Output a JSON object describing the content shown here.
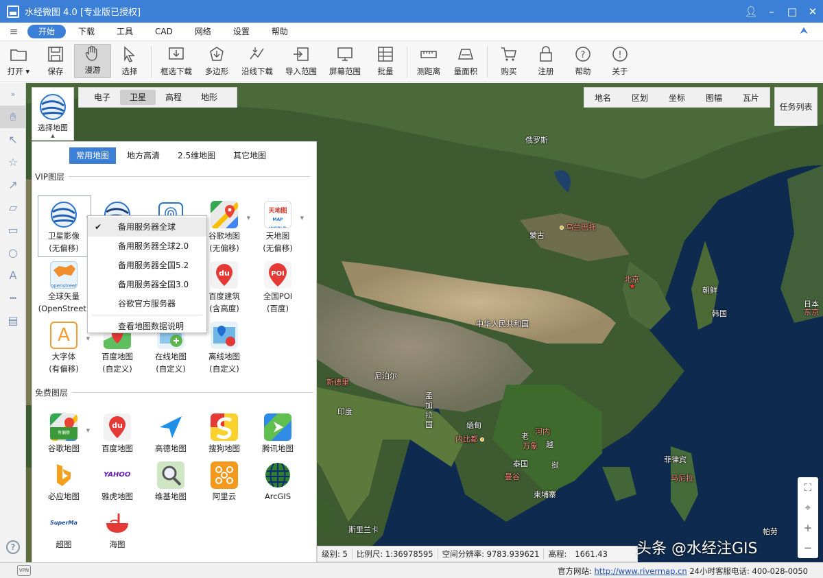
{
  "titlebar": {
    "title": "水经微图 4.0 [专业版已授权]"
  },
  "menu": {
    "items": [
      "开始",
      "下载",
      "工具",
      "CAD",
      "网络",
      "设置",
      "帮助"
    ],
    "active": "开始"
  },
  "ribbon": {
    "buttons": [
      {
        "label": "打开 ▾",
        "icon": "folder-icon"
      },
      {
        "label": "保存",
        "icon": "save-icon"
      },
      {
        "label": "漫游",
        "icon": "hand-icon",
        "active": true
      },
      {
        "label": "选择",
        "icon": "cursor-icon"
      },
      {
        "label": "框选下载",
        "icon": "box-download-icon"
      },
      {
        "label": "多边形",
        "icon": "polygon-download-icon"
      },
      {
        "label": "沿线下载",
        "icon": "line-download-icon"
      },
      {
        "label": "导入范围",
        "icon": "import-range-icon"
      },
      {
        "label": "屏幕范围",
        "icon": "screen-range-icon"
      },
      {
        "label": "批量",
        "icon": "batch-icon"
      },
      {
        "label": "测距离",
        "icon": "ruler-icon"
      },
      {
        "label": "量面积",
        "icon": "area-icon"
      },
      {
        "label": "购买",
        "icon": "cart-icon"
      },
      {
        "label": "注册",
        "icon": "lock-icon"
      },
      {
        "label": "帮助",
        "icon": "help-icon"
      },
      {
        "label": "关于",
        "icon": "info-icon"
      }
    ]
  },
  "map_types": {
    "items": [
      "电子",
      "卫星",
      "高程",
      "地形"
    ],
    "active": "卫星"
  },
  "right_bar": {
    "items": [
      "地名",
      "区划",
      "坐标",
      "图幅",
      "瓦片"
    ]
  },
  "task_list": {
    "label": "任务列表"
  },
  "select_map": {
    "label": "选择地图"
  },
  "panel": {
    "tabs": [
      "常用地图",
      "地方高清",
      "2.5维地图",
      "其它地图"
    ],
    "active_tab": "常用地图",
    "vip_title": "VIP图层",
    "free_title": "免费图层",
    "vip_tiles": [
      {
        "line1": "卫星影像",
        "line2": "(无偏移)",
        "icon": "globe-icon"
      },
      {
        "line1": "",
        "line2": "",
        "icon": "globe-icon"
      },
      {
        "line1": "",
        "line2": "",
        "icon": "fingerprint-icon"
      },
      {
        "line1": "谷歌地图",
        "line2": "(无偏移)",
        "icon": "google-maps-icon"
      },
      {
        "line1": "天地图",
        "line2": "(无偏移)",
        "icon": "tianditu-icon"
      },
      {
        "line1": "全球矢量",
        "line2": "(OpenStreet)",
        "icon": "openstreet-icon"
      },
      {
        "line1": "百度建筑",
        "line2": "(含高度)",
        "icon": "baidu-building-icon"
      },
      {
        "line1": "全国POI",
        "line2": "(百度)",
        "icon": "poi-icon"
      },
      {
        "line1": "大字体",
        "line2": "(有偏移)",
        "icon": "large-font-icon"
      },
      {
        "line1": "百度地图",
        "line2": "(自定义)",
        "icon": "baidu-custom-icon"
      },
      {
        "line1": "在线地图",
        "line2": "(自定义)",
        "icon": "online-map-icon"
      },
      {
        "line1": "离线地图",
        "line2": "(自定义)",
        "icon": "offline-map-icon"
      }
    ],
    "free_tiles": [
      {
        "line1": "谷歌地图",
        "icon": "google-maps-icon"
      },
      {
        "line1": "百度地图",
        "icon": "baidu-map-icon"
      },
      {
        "line1": "高德地图",
        "icon": "gaode-icon"
      },
      {
        "line1": "搜狗地图",
        "icon": "sogou-icon"
      },
      {
        "line1": "腾讯地图",
        "icon": "tencent-map-icon"
      },
      {
        "line1": "必应地图",
        "icon": "bing-icon"
      },
      {
        "line1": "雅虎地图",
        "icon": "yahoo-icon"
      },
      {
        "line1": "维基地图",
        "icon": "wiki-map-icon"
      },
      {
        "line1": "阿里云",
        "icon": "aliyun-icon"
      },
      {
        "line1": "ArcGIS",
        "icon": "arcgis-icon"
      },
      {
        "line1": "超图",
        "icon": "supermap-icon"
      },
      {
        "line1": "海图",
        "icon": "sea-chart-icon"
      }
    ],
    "tile_texts": {
      "openstreet_badge": "openstreet",
      "poi_badge": "POI",
      "baidu_du": "du",
      "yahoo": "YAHOO!",
      "supermap": "SuperMap",
      "tianditu": "天地图",
      "tianditu_sub": "MAP WORLD",
      "google_sub": "有偏移",
      "large_font": "A"
    }
  },
  "dropdown": {
    "items": [
      "备用服务器全球",
      "备用服务器全球2.0",
      "备用服务器全国5.2",
      "备用服务器全国3.0",
      "谷歌官方服务器",
      "查看地图数据说明"
    ],
    "checked": "备用服务器全球"
  },
  "map_labels": {
    "russia": "俄罗斯",
    "mongolia": "蒙古",
    "ulaanbaatar": "乌兰巴托",
    "beijing": "北京",
    "korea_n": "朝鲜",
    "korea_s": "韩国",
    "japan": "日本",
    "tokyo": "东京",
    "china": "中华人民共和国",
    "nepal": "尼泊尔",
    "newdelhi": "新德里",
    "bangladesh_a": "孟",
    "bangladesh_b": "加",
    "bangladesh_c": "拉",
    "bangladesh_d": "国",
    "india": "印度",
    "myanmar": "缅甸",
    "naypyidaw": "内比都",
    "hanoi": "河内",
    "laos": "老",
    "vientiane": "万象",
    "vietnam": "越",
    "thailand": "泰国",
    "bangkok": "曼谷",
    "cambodia": "柬埔寨",
    "vietnam2": "挝",
    "philippines": "菲律宾",
    "manila": "马尼拉",
    "srilanka": "斯里兰卡",
    "palau": "帕劳"
  },
  "status": {
    "level": "级别: 5",
    "scale": "比例尺: 1:36978595",
    "resolution": "空间分辨率: 9783.939621",
    "elevation": "高程:",
    "elev_value": "1661.43"
  },
  "watermark": "头条 @水经注GIS",
  "footer": {
    "site_label": "官方网站:",
    "site_url": "http://www.rivermap.cn",
    "hotline": "24小时客服电话: 400-028-0050",
    "vpn": "VPN"
  },
  "colors": {
    "accent": "#3b7fd6",
    "map_ocean": "#0c2848"
  }
}
